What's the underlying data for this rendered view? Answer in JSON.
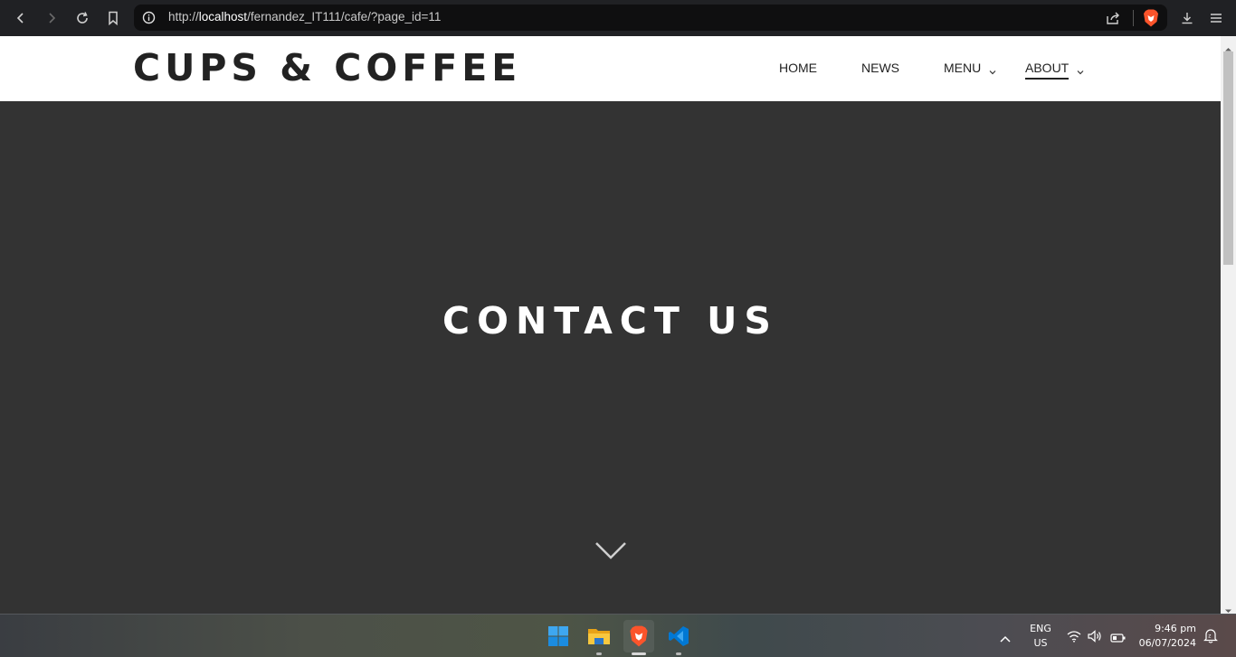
{
  "browser": {
    "url_prefix": "http://",
    "url_host": "localhost",
    "url_path": "/fernandez_IT111/cafe/?page_id=11"
  },
  "site": {
    "title": "CUPS & COFFEE",
    "nav": {
      "home": "HOME",
      "news": "NEWS",
      "menu": "MENU",
      "about": "ABOUT"
    },
    "active_nav": "ABOUT"
  },
  "hero": {
    "title": "CONTACT US"
  },
  "taskbar": {
    "lang_top": "ENG",
    "lang_bottom": "US",
    "time": "9:46 pm",
    "date": "06/07/2024"
  },
  "colors": {
    "hero_bg": "#333333",
    "header_bg": "#ffffff",
    "title_text": "#222222",
    "brave_orange": "#fb542b",
    "vscode_blue": "#0078d4"
  }
}
